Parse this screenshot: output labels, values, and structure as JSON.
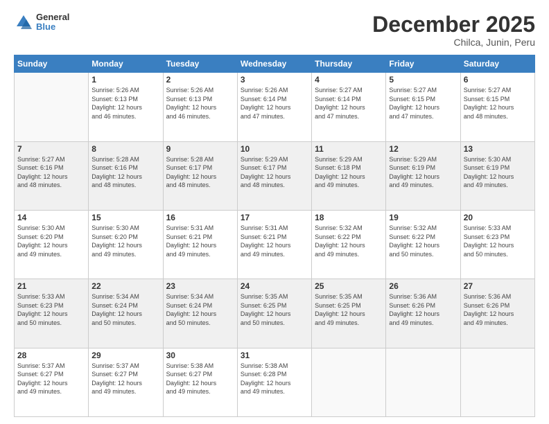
{
  "header": {
    "logo_general": "General",
    "logo_blue": "Blue",
    "month_title": "December 2025",
    "subtitle": "Chilca, Junin, Peru"
  },
  "days_of_week": [
    "Sunday",
    "Monday",
    "Tuesday",
    "Wednesday",
    "Thursday",
    "Friday",
    "Saturday"
  ],
  "weeks": [
    [
      {
        "num": "",
        "sunrise": "",
        "sunset": "",
        "daylight": "",
        "empty": true
      },
      {
        "num": "1",
        "sunrise": "Sunrise: 5:26 AM",
        "sunset": "Sunset: 6:13 PM",
        "daylight": "Daylight: 12 hours and 46 minutes."
      },
      {
        "num": "2",
        "sunrise": "Sunrise: 5:26 AM",
        "sunset": "Sunset: 6:13 PM",
        "daylight": "Daylight: 12 hours and 46 minutes."
      },
      {
        "num": "3",
        "sunrise": "Sunrise: 5:26 AM",
        "sunset": "Sunset: 6:14 PM",
        "daylight": "Daylight: 12 hours and 47 minutes."
      },
      {
        "num": "4",
        "sunrise": "Sunrise: 5:27 AM",
        "sunset": "Sunset: 6:14 PM",
        "daylight": "Daylight: 12 hours and 47 minutes."
      },
      {
        "num": "5",
        "sunrise": "Sunrise: 5:27 AM",
        "sunset": "Sunset: 6:15 PM",
        "daylight": "Daylight: 12 hours and 47 minutes."
      },
      {
        "num": "6",
        "sunrise": "Sunrise: 5:27 AM",
        "sunset": "Sunset: 6:15 PM",
        "daylight": "Daylight: 12 hours and 48 minutes."
      }
    ],
    [
      {
        "num": "7",
        "sunrise": "Sunrise: 5:27 AM",
        "sunset": "Sunset: 6:16 PM",
        "daylight": "Daylight: 12 hours and 48 minutes."
      },
      {
        "num": "8",
        "sunrise": "Sunrise: 5:28 AM",
        "sunset": "Sunset: 6:16 PM",
        "daylight": "Daylight: 12 hours and 48 minutes."
      },
      {
        "num": "9",
        "sunrise": "Sunrise: 5:28 AM",
        "sunset": "Sunset: 6:17 PM",
        "daylight": "Daylight: 12 hours and 48 minutes."
      },
      {
        "num": "10",
        "sunrise": "Sunrise: 5:29 AM",
        "sunset": "Sunset: 6:17 PM",
        "daylight": "Daylight: 12 hours and 48 minutes."
      },
      {
        "num": "11",
        "sunrise": "Sunrise: 5:29 AM",
        "sunset": "Sunset: 6:18 PM",
        "daylight": "Daylight: 12 hours and 49 minutes."
      },
      {
        "num": "12",
        "sunrise": "Sunrise: 5:29 AM",
        "sunset": "Sunset: 6:19 PM",
        "daylight": "Daylight: 12 hours and 49 minutes."
      },
      {
        "num": "13",
        "sunrise": "Sunrise: 5:30 AM",
        "sunset": "Sunset: 6:19 PM",
        "daylight": "Daylight: 12 hours and 49 minutes."
      }
    ],
    [
      {
        "num": "14",
        "sunrise": "Sunrise: 5:30 AM",
        "sunset": "Sunset: 6:20 PM",
        "daylight": "Daylight: 12 hours and 49 minutes."
      },
      {
        "num": "15",
        "sunrise": "Sunrise: 5:30 AM",
        "sunset": "Sunset: 6:20 PM",
        "daylight": "Daylight: 12 hours and 49 minutes."
      },
      {
        "num": "16",
        "sunrise": "Sunrise: 5:31 AM",
        "sunset": "Sunset: 6:21 PM",
        "daylight": "Daylight: 12 hours and 49 minutes."
      },
      {
        "num": "17",
        "sunrise": "Sunrise: 5:31 AM",
        "sunset": "Sunset: 6:21 PM",
        "daylight": "Daylight: 12 hours and 49 minutes."
      },
      {
        "num": "18",
        "sunrise": "Sunrise: 5:32 AM",
        "sunset": "Sunset: 6:22 PM",
        "daylight": "Daylight: 12 hours and 49 minutes."
      },
      {
        "num": "19",
        "sunrise": "Sunrise: 5:32 AM",
        "sunset": "Sunset: 6:22 PM",
        "daylight": "Daylight: 12 hours and 50 minutes."
      },
      {
        "num": "20",
        "sunrise": "Sunrise: 5:33 AM",
        "sunset": "Sunset: 6:23 PM",
        "daylight": "Daylight: 12 hours and 50 minutes."
      }
    ],
    [
      {
        "num": "21",
        "sunrise": "Sunrise: 5:33 AM",
        "sunset": "Sunset: 6:23 PM",
        "daylight": "Daylight: 12 hours and 50 minutes."
      },
      {
        "num": "22",
        "sunrise": "Sunrise: 5:34 AM",
        "sunset": "Sunset: 6:24 PM",
        "daylight": "Daylight: 12 hours and 50 minutes."
      },
      {
        "num": "23",
        "sunrise": "Sunrise: 5:34 AM",
        "sunset": "Sunset: 6:24 PM",
        "daylight": "Daylight: 12 hours and 50 minutes."
      },
      {
        "num": "24",
        "sunrise": "Sunrise: 5:35 AM",
        "sunset": "Sunset: 6:25 PM",
        "daylight": "Daylight: 12 hours and 50 minutes."
      },
      {
        "num": "25",
        "sunrise": "Sunrise: 5:35 AM",
        "sunset": "Sunset: 6:25 PM",
        "daylight": "Daylight: 12 hours and 49 minutes."
      },
      {
        "num": "26",
        "sunrise": "Sunrise: 5:36 AM",
        "sunset": "Sunset: 6:26 PM",
        "daylight": "Daylight: 12 hours and 49 minutes."
      },
      {
        "num": "27",
        "sunrise": "Sunrise: 5:36 AM",
        "sunset": "Sunset: 6:26 PM",
        "daylight": "Daylight: 12 hours and 49 minutes."
      }
    ],
    [
      {
        "num": "28",
        "sunrise": "Sunrise: 5:37 AM",
        "sunset": "Sunset: 6:27 PM",
        "daylight": "Daylight: 12 hours and 49 minutes."
      },
      {
        "num": "29",
        "sunrise": "Sunrise: 5:37 AM",
        "sunset": "Sunset: 6:27 PM",
        "daylight": "Daylight: 12 hours and 49 minutes."
      },
      {
        "num": "30",
        "sunrise": "Sunrise: 5:38 AM",
        "sunset": "Sunset: 6:27 PM",
        "daylight": "Daylight: 12 hours and 49 minutes."
      },
      {
        "num": "31",
        "sunrise": "Sunrise: 5:38 AM",
        "sunset": "Sunset: 6:28 PM",
        "daylight": "Daylight: 12 hours and 49 minutes."
      },
      {
        "num": "",
        "sunrise": "",
        "sunset": "",
        "daylight": "",
        "empty": true
      },
      {
        "num": "",
        "sunrise": "",
        "sunset": "",
        "daylight": "",
        "empty": true
      },
      {
        "num": "",
        "sunrise": "",
        "sunset": "",
        "daylight": "",
        "empty": true
      }
    ]
  ]
}
